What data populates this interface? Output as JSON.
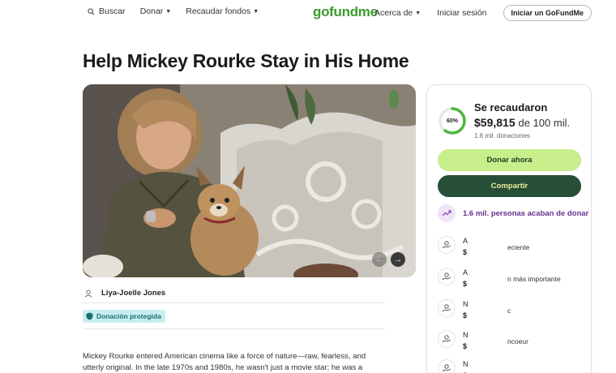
{
  "header": {
    "search_label": "Buscar",
    "donate_label": "Donar",
    "fundraise_label": "Recaudar fondos",
    "logo": "gofundme",
    "about_label": "Acerca de",
    "signin_label": "Iniciar sesión",
    "start_label": "Iniciar un GoFundMe"
  },
  "campaign": {
    "title": "Help Mickey Rourke Stay in His Home",
    "organizer": "Liya-Joelle Jones",
    "protected_label": "Donación protegida",
    "story": "Mickey Rourke entered American cinema like a force of nature—raw, fearless, and utterly original. In the late 1970s and 1980s, he wasn't just a movie star; he was a symbol of"
  },
  "progress": {
    "percent_label": "60%",
    "fraction": 0.6,
    "raised_label": "Se recaudaron",
    "amount": "$59,815",
    "goal": "de 100 mil.",
    "donations": "1.6 mil. donaciones"
  },
  "actions": {
    "donate_now": "Donar ahora",
    "share": "Compartir"
  },
  "trend": {
    "text": "1.6 mil. personas acaban de donar"
  },
  "donors": [
    {
      "name": "A",
      "amount": "$",
      "tag": "eciente"
    },
    {
      "name": "A",
      "amount": "$",
      "tag": "n más importante"
    },
    {
      "name": "N",
      "amount": "$",
      "tag": "c"
    },
    {
      "name": "N",
      "amount": "$",
      "tag": "ncoeur"
    },
    {
      "name": "N",
      "amount": "$",
      "tag": ""
    }
  ],
  "colors": {
    "brand": "#3b9b2e",
    "donate_button": "#c8ee8b",
    "share_button": "#274e37",
    "trend": "#6a2f8f",
    "protected_badge": "#c7eff0"
  }
}
